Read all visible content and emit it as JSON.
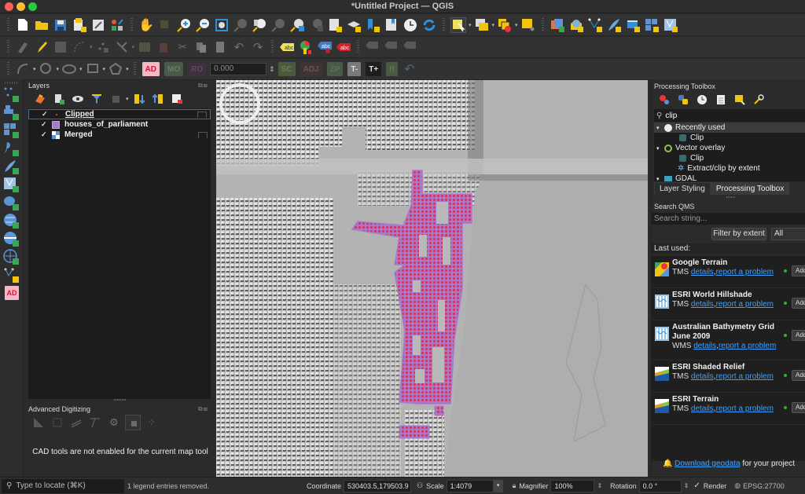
{
  "window": {
    "title": "*Untitled Project — QGIS"
  },
  "colors": {
    "accent_link": "#3ea0ff",
    "polygon_fill": "#a77bc9",
    "clipped_point": "#e0315a",
    "status_ok": "#2ab52a",
    "ad_button": "#f6b8c4"
  },
  "toolbar_row1": {
    "icons": [
      "new-project-icon",
      "open-project-icon",
      "save-project-icon",
      "new-print-layout-icon",
      "layout-manager-icon",
      "style-manager-icon",
      "pan-icon",
      "pan-to-selection-icon",
      "zoom-in-icon",
      "zoom-out-icon",
      "zoom-full-icon",
      "zoom-to-selection-icon",
      "zoom-to-layer-icon",
      "zoom-native-icon",
      "zoom-last-icon",
      "zoom-next-icon",
      "new-bookmark-icon",
      "show-bookmarks-icon",
      "new-spatial-bookmark-icon",
      "temporal-controller-icon",
      "refresh-icon",
      "select-features-icon",
      "select-by-value-icon",
      "deselect-icon",
      "select-location-icon",
      "new-layer-icon",
      "new-geopackage-icon",
      "new-vertex-layer-icon",
      "new-spatialite-icon",
      "new-virtual-layer-icon",
      "new-mesh-layer-icon",
      "new-vector-icon"
    ]
  },
  "toolbar_row2": {
    "icons": [
      "current-edits-icon",
      "toggle-editing-icon",
      "save-edits-icon",
      "digitize-line-icon",
      "add-point-icon",
      "vertex-tool-icon",
      "modify-attributes-icon",
      "delete-selected-icon",
      "cut-features-icon",
      "copy-features-icon",
      "paste-features-icon",
      "undo-icon",
      "redo-icon",
      "label-tool-icon",
      "diagram-tool-icon",
      "pin-label-icon",
      "highlight-pinned-icon",
      "move-label-icon",
      "rotate-label-icon",
      "change-label-icon"
    ]
  },
  "toolbar_row3": {
    "icons": [
      "add-circular-string-icon",
      "add-circle-icon",
      "add-ellipse-icon",
      "add-rectangle-icon",
      "add-polygon-icon"
    ],
    "ad_label": "AD",
    "mo_label": "MO",
    "ro_label": "RO",
    "tolerance_value": "0.000",
    "sc_label": "SC",
    "adj_label": "ADJ",
    "zp_label": "ZP",
    "t_minus_label": "T-",
    "t_plus_label": "T+",
    "bang_label": "!!"
  },
  "left_toolbar": {
    "icons": [
      "add-vector-vertex-icon",
      "add-raster-icon",
      "add-mesh-icon",
      "add-delimited-text-icon",
      "add-spatialite-icon",
      "add-virtual-layer-icon",
      "add-postgis-icon",
      "add-wms-icon",
      "add-wfs-icon",
      "add-xyz-icon",
      "new-temp-layer-icon"
    ],
    "ad_label": "AD"
  },
  "layers_panel": {
    "title": "Layers",
    "toolbar_icons": [
      "style-panel-icon",
      "add-group-icon",
      "manage-visibility-icon",
      "filter-legend-icon",
      "filter-expression-icon",
      "expand-all-icon",
      "collapse-all-icon",
      "remove-layer-icon"
    ],
    "layers": [
      {
        "name": "Clipped",
        "checked": true,
        "type": "point"
      },
      {
        "name": "houses_of_parliament",
        "checked": true,
        "type": "polygon"
      },
      {
        "name": "Merged",
        "checked": true,
        "type": "raster"
      }
    ]
  },
  "advanced_digitizing": {
    "title": "Advanced Digitizing",
    "message": "CAD tools are not enabled for the current map tool"
  },
  "processing_toolbox": {
    "title": "Processing Toolbox",
    "search_value": "clip",
    "tree": [
      {
        "label": "Recently used",
        "level": 0,
        "expanded": true,
        "selected": true
      },
      {
        "label": "Clip",
        "level": 1
      },
      {
        "label": "Vector overlay",
        "level": 0,
        "expanded": true
      },
      {
        "label": "Clip",
        "level": 1
      },
      {
        "label": "Extract/clip by extent",
        "level": 1
      },
      {
        "label": "GDAL",
        "level": 0,
        "expanded": true
      }
    ],
    "tabs": [
      {
        "label": "Layer Styling",
        "active": false
      },
      {
        "label": "Processing Toolbox",
        "active": true
      }
    ]
  },
  "search_qms": {
    "title": "Search QMS",
    "search_placeholder": "Search string...",
    "filter_button": "Filter by extent",
    "filter_select": "All",
    "last_used_label": "Last used:",
    "items": [
      {
        "name": "Google Terrain",
        "type": "TMS",
        "details": "details",
        "report": "report a problem",
        "add": "Add",
        "icon": "google-maps-icon"
      },
      {
        "name": "ESRI World Hillshade",
        "type": "TMS",
        "details": "details",
        "report": "report a problem",
        "add": "Add",
        "icon": "qms-map-icon"
      },
      {
        "name": "Australian Bathymetry Grid June 2009",
        "type": "WMS",
        "details": "details",
        "report": "report a problem",
        "add": "Add",
        "icon": "qms-map-icon"
      },
      {
        "name": "ESRI Shaded Relief",
        "type": "TMS",
        "details": "details",
        "report": "report a problem",
        "add": "Add",
        "icon": "esri-icon"
      },
      {
        "name": "ESRI Terrain",
        "type": "TMS",
        "details": "details",
        "report": "report a problem",
        "add": "Add",
        "icon": "esri-icon"
      }
    ],
    "download_link": "Download geodata",
    "download_suffix": " for your project"
  },
  "statusbar": {
    "locate_placeholder": "Type to locate (⌘K)",
    "message": "1 legend entries removed.",
    "coordinate_label": "Coordinate",
    "coordinate_value": "530403.5,179503.9",
    "scale_label": "Scale",
    "scale_value": "1:4079",
    "magnifier_label": "Magnifier",
    "magnifier_value": "100%",
    "rotation_label": "Rotation",
    "rotation_value": "0.0 °",
    "render_label": "Render",
    "render_checked": true,
    "crs_label": "EPSG:27700"
  }
}
